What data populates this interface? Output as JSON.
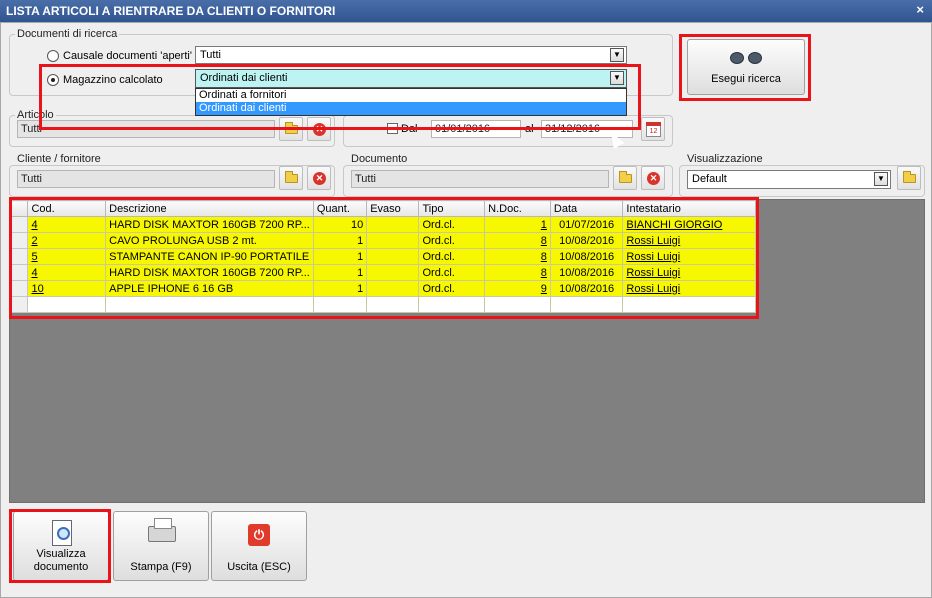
{
  "window": {
    "title": "LISTA ARTICOLI A RIENTRARE DA CLIENTI O FORNITORI",
    "close_glyph": "×"
  },
  "search_docs": {
    "legend": "Documenti di ricerca",
    "radio1_label": "Causale documenti 'aperti'",
    "radio1_value": "Tutti",
    "radio2_label": "Magazzino calcolato",
    "radio2_value": "Ordinati dai clienti",
    "dropdown_options": [
      "Ordinati a fornitori",
      "Ordinati dai clienti"
    ]
  },
  "execute_label": "Esegui ricerca",
  "articolo": {
    "legend": "Articolo",
    "value": "Tutti"
  },
  "dates": {
    "dal_label": "Dal",
    "from": "01/01/2016",
    "al_label": "al",
    "to": "31/12/2016"
  },
  "cliente": {
    "legend": "Cliente / fornitore",
    "value": "Tutti"
  },
  "documento": {
    "legend": "Documento",
    "value": "Tutti"
  },
  "visualizzazione": {
    "legend": "Visualizzazione",
    "value": "Default"
  },
  "grid": {
    "headers": [
      "Cod.",
      "Descrizione",
      "Quant.",
      "Evaso",
      "Tipo",
      "N.Doc.",
      "Data",
      "Intestatario"
    ],
    "rows": [
      {
        "cod": "4",
        "desc": "HARD DISK MAXTOR 160GB 7200 RP...",
        "qty": "10",
        "evaso": "",
        "tipo": "Ord.cl.",
        "ndoc": "1",
        "data": "01/07/2016",
        "intest": "BIANCHI GIORGIO"
      },
      {
        "cod": "2",
        "desc": "CAVO PROLUNGA USB 2 mt.",
        "qty": "1",
        "evaso": "",
        "tipo": "Ord.cl.",
        "ndoc": "8",
        "data": "10/08/2016",
        "intest": "Rossi Luigi"
      },
      {
        "cod": "5",
        "desc": "STAMPANTE CANON IP-90 PORTATILE",
        "qty": "1",
        "evaso": "",
        "tipo": "Ord.cl.",
        "ndoc": "8",
        "data": "10/08/2016",
        "intest": "Rossi Luigi"
      },
      {
        "cod": "4",
        "desc": "HARD DISK MAXTOR 160GB 7200 RP...",
        "qty": "1",
        "evaso": "",
        "tipo": "Ord.cl.",
        "ndoc": "8",
        "data": "10/08/2016",
        "intest": "Rossi Luigi"
      },
      {
        "cod": "10",
        "desc": "APPLE IPHONE 6 16 GB",
        "qty": "1",
        "evaso": "",
        "tipo": "Ord.cl.",
        "ndoc": "9",
        "data": "10/08/2016",
        "intest": "Rossi Luigi"
      }
    ]
  },
  "buttons": {
    "visualizza_line1": "Visualizza",
    "visualizza_line2": "documento",
    "stampa": "Stampa (F9)",
    "uscita": "Uscita (ESC)"
  },
  "colors": {
    "row_highlight": "#f7f700",
    "annotation": "#e8141a",
    "combo_open_bg": "#bdf3f3",
    "selection": "#3399ff"
  }
}
